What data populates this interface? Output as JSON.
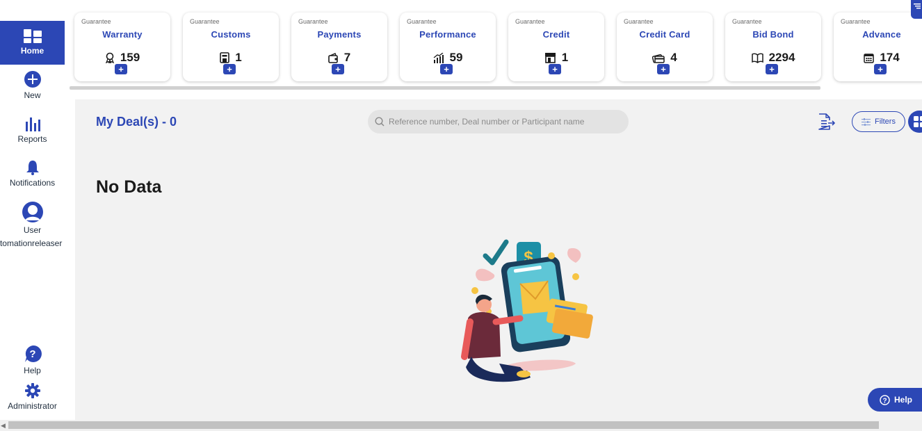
{
  "sidebar": {
    "items": [
      {
        "label": "Home",
        "icon": "home-grid-icon"
      },
      {
        "label": "New",
        "icon": "plus-circle-icon"
      },
      {
        "label": "Reports",
        "icon": "bar-chart-icon"
      },
      {
        "label": "Notifications",
        "icon": "bell-icon"
      },
      {
        "label": "User",
        "icon": "user-icon"
      },
      {
        "label": "Help",
        "icon": "help-icon"
      },
      {
        "label": "Administrator",
        "icon": "gear-icon"
      }
    ],
    "username": "automationreleaser"
  },
  "cards": [
    {
      "kind": "Guarantee",
      "title": "Warranty",
      "count": "159",
      "icon": "award-icon"
    },
    {
      "kind": "Guarantee",
      "title": "Customs",
      "count": "1",
      "icon": "building-icon"
    },
    {
      "kind": "Guarantee",
      "title": "Payments",
      "count": "7",
      "icon": "wallet-icon"
    },
    {
      "kind": "Guarantee",
      "title": "Performance",
      "count": "59",
      "icon": "growth-chart-icon"
    },
    {
      "kind": "Guarantee",
      "title": "Credit",
      "count": "1",
      "icon": "store-icon"
    },
    {
      "kind": "Guarantee",
      "title": "Credit Card",
      "count": "4",
      "icon": "cards-icon"
    },
    {
      "kind": "Guarantee",
      "title": "Bid Bond",
      "count": "2294",
      "icon": "book-icon"
    },
    {
      "kind": "Guarantee",
      "title": "Advance",
      "count": "174",
      "icon": "calendar-icon"
    }
  ],
  "card_add_label": "+",
  "main": {
    "title": "My Deal(s) - 0",
    "search_placeholder": "Reference number, Deal number or Participant name",
    "filters_label": "Filters",
    "empty_text": "No Data"
  },
  "help_button": {
    "label": "Help"
  },
  "colors": {
    "accent": "#2c47b5",
    "panel": "#f2f2f2"
  }
}
